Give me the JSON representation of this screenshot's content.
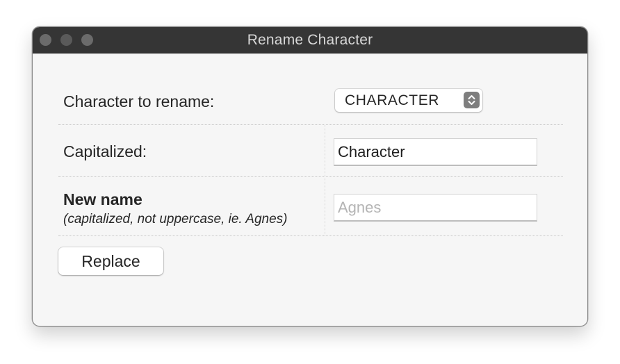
{
  "window": {
    "title": "Rename Character"
  },
  "form": {
    "character_label": "Character to rename:",
    "character_value": "CHARACTER",
    "capitalized_label": "Capitalized:",
    "capitalized_value": "Character",
    "new_name_label": "New name",
    "new_name_hint": "(capitalized, not uppercase, ie. Agnes)",
    "new_name_placeholder": "Agnes",
    "replace_label": "Replace"
  },
  "icons": {
    "close": "window-close-icon",
    "minimize": "window-minimize-icon",
    "zoom": "window-zoom-icon",
    "popup": "chevron-updown-icon"
  }
}
